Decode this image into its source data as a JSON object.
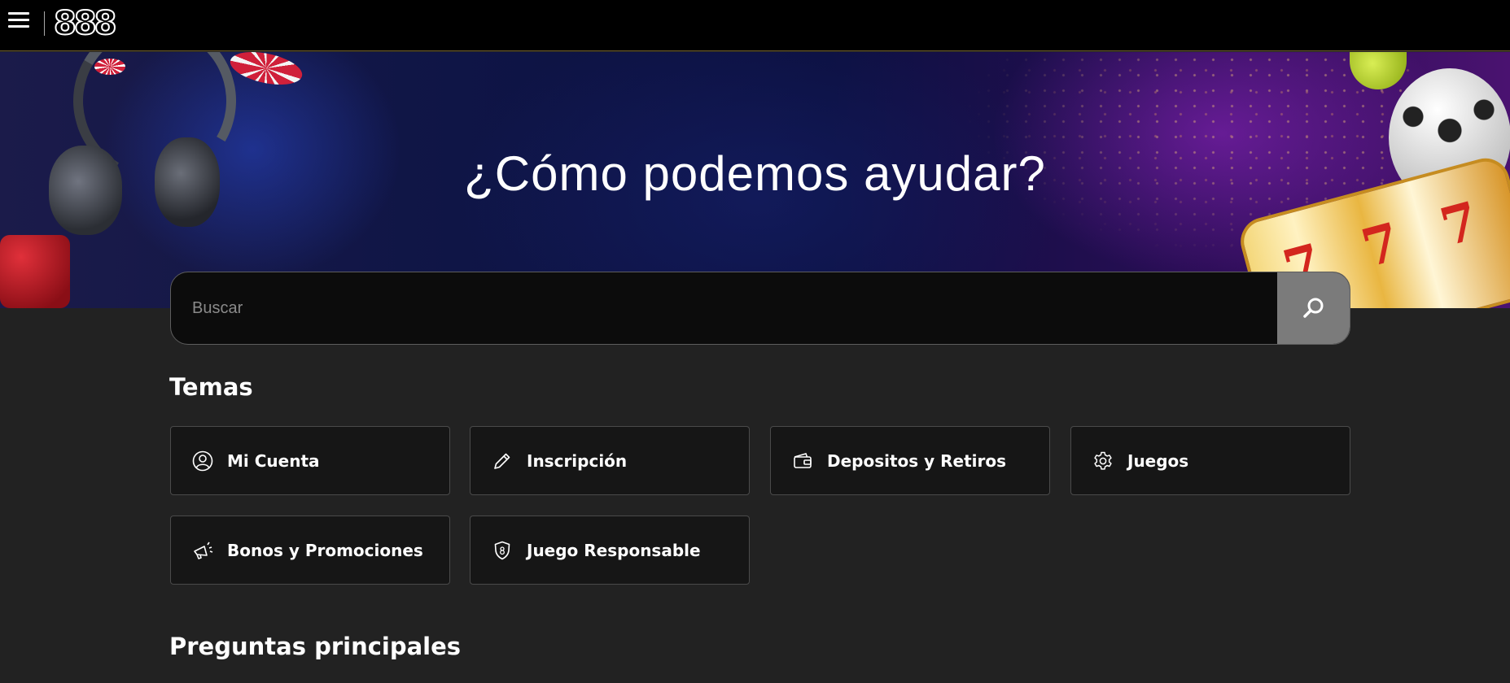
{
  "topbar": {
    "menu_icon": "hamburger-menu-icon",
    "logo_text": "888"
  },
  "hero": {
    "title": "¿Cómo podemos ayudar?",
    "slot_symbol": "7"
  },
  "search": {
    "placeholder": "Buscar",
    "value": "",
    "button_icon": "search-icon"
  },
  "topics": {
    "heading": "Temas",
    "items": [
      {
        "label": "Mi Cuenta",
        "icon": "user-icon"
      },
      {
        "label": "Inscripción",
        "icon": "pencil-icon"
      },
      {
        "label": "Depositos y Retiros",
        "icon": "wallet-icon"
      },
      {
        "label": "Juegos",
        "icon": "gear-icon"
      },
      {
        "label": "Bonos y Promociones",
        "icon": "megaphone-icon"
      },
      {
        "label": "Juego Responsable",
        "icon": "shield-icon"
      }
    ]
  },
  "faq": {
    "heading": "Preguntas principales"
  },
  "colors": {
    "background": "#222222",
    "topbar": "#000000",
    "card": "#161616",
    "search_button": "#7b7b7b"
  }
}
